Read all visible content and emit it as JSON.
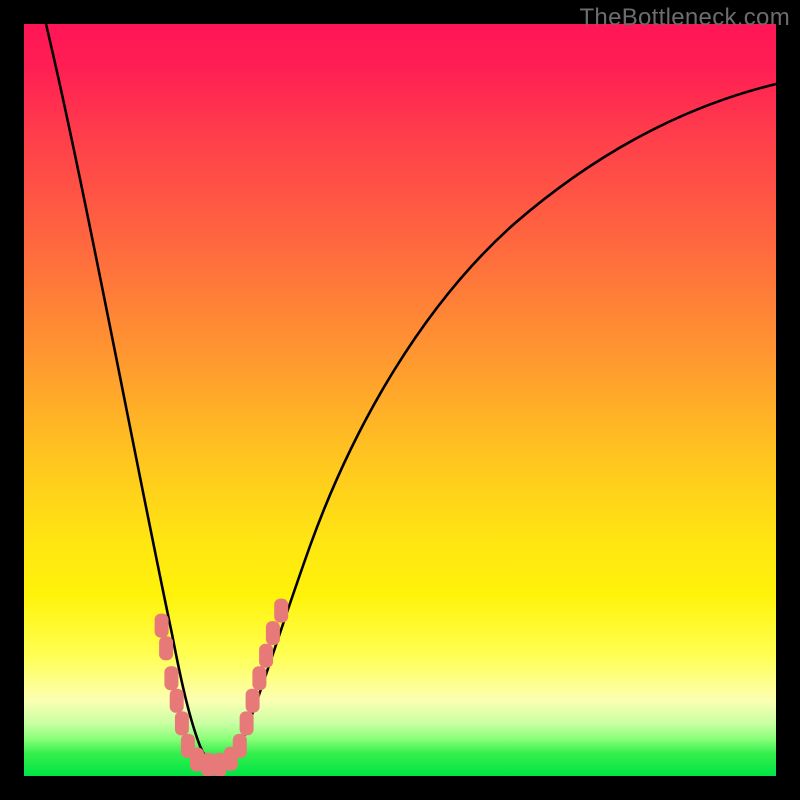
{
  "watermark": "TheBottleneck.com",
  "chart_data": {
    "type": "line",
    "title": "",
    "xlabel": "",
    "ylabel": "",
    "xlim": [
      0,
      100
    ],
    "ylim": [
      0,
      100
    ],
    "series": [
      {
        "name": "left-branch",
        "x": [
          3,
          5,
          7,
          9,
          11,
          13,
          15,
          17,
          19,
          20,
          21,
          22,
          23
        ],
        "values": [
          100,
          88,
          76,
          65,
          54,
          43,
          33,
          23,
          13,
          8,
          4,
          2,
          1
        ]
      },
      {
        "name": "right-branch",
        "x": [
          27,
          28,
          29,
          30,
          31,
          33,
          36,
          40,
          45,
          50,
          56,
          63,
          71,
          80,
          90,
          100
        ],
        "values": [
          1,
          2,
          4,
          7,
          10,
          15,
          22,
          31,
          40,
          48,
          56,
          63,
          70,
          76,
          82,
          87
        ]
      }
    ],
    "markers": [
      {
        "x": 18.3,
        "y": 20,
        "label": "left-marker-1"
      },
      {
        "x": 18.9,
        "y": 17,
        "label": "left-marker-2"
      },
      {
        "x": 19.6,
        "y": 13,
        "label": "left-marker-3"
      },
      {
        "x": 20.3,
        "y": 10,
        "label": "left-marker-4"
      },
      {
        "x": 21.0,
        "y": 7,
        "label": "left-marker-5"
      },
      {
        "x": 21.8,
        "y": 4,
        "label": "left-marker-6"
      },
      {
        "x": 23.0,
        "y": 2.2,
        "label": "bottom-marker-1"
      },
      {
        "x": 24.5,
        "y": 1.5,
        "label": "bottom-marker-2"
      },
      {
        "x": 26.0,
        "y": 1.5,
        "label": "bottom-marker-3"
      },
      {
        "x": 27.5,
        "y": 2.3,
        "label": "bottom-marker-4"
      },
      {
        "x": 28.7,
        "y": 4,
        "label": "right-marker-1"
      },
      {
        "x": 29.6,
        "y": 7,
        "label": "right-marker-2"
      },
      {
        "x": 30.4,
        "y": 10,
        "label": "right-marker-3"
      },
      {
        "x": 31.3,
        "y": 13,
        "label": "right-marker-4"
      },
      {
        "x": 32.2,
        "y": 16,
        "label": "right-marker-5"
      },
      {
        "x": 33.1,
        "y": 19,
        "label": "right-marker-6"
      },
      {
        "x": 34.2,
        "y": 22,
        "label": "right-marker-7"
      }
    ],
    "marker_style": {
      "shape": "rounded-rect",
      "fill": "#e77a79",
      "width": 14,
      "height": 24,
      "rx": 6
    },
    "curve_style": {
      "stroke": "#000000",
      "width": 2.6
    },
    "gradient_stops": [
      {
        "pos": 0,
        "color": "#ff1556"
      },
      {
        "pos": 45,
        "color": "#ff9a2f"
      },
      {
        "pos": 76,
        "color": "#fff30a"
      },
      {
        "pos": 100,
        "color": "#00e544"
      }
    ]
  }
}
